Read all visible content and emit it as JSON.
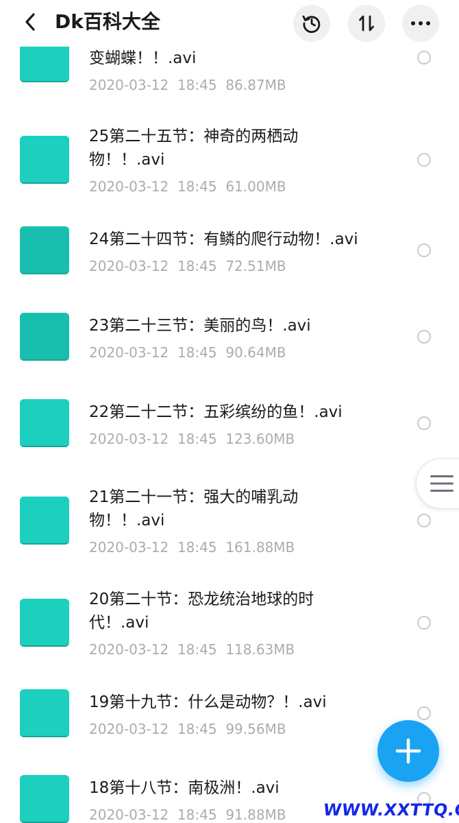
{
  "header": {
    "title": "Dk百科大全",
    "icons": {
      "back": "chevron-left-icon",
      "history": "history-icon",
      "sort": "sort-icon",
      "more": "more-dots-icon"
    }
  },
  "files": [
    {
      "name": "变蝴蝶！！.avi",
      "date": "2020-03-12",
      "time": "18:45",
      "size": "86.87MB"
    },
    {
      "name": "25第二十五节：神奇的两栖动物！！.avi",
      "date": "2020-03-12",
      "time": "18:45",
      "size": "61.00MB"
    },
    {
      "name": "24第二十四节：有鳞的爬行动物！.avi",
      "date": "2020-03-12",
      "time": "18:45",
      "size": "72.51MB"
    },
    {
      "name": "23第二十三节：美丽的鸟！.avi",
      "date": "2020-03-12",
      "time": "18:45",
      "size": "90.64MB"
    },
    {
      "name": "22第二十二节：五彩缤纷的鱼！.avi",
      "date": "2020-03-12",
      "time": "18:45",
      "size": "123.60MB"
    },
    {
      "name": "21第二十一节：强大的哺乳动物！！.avi",
      "date": "2020-03-12",
      "time": "18:45",
      "size": "161.88MB"
    },
    {
      "name": "20第二十节：恐龙统治地球的时代！.avi",
      "date": "2020-03-12",
      "time": "18:45",
      "size": "118.63MB"
    },
    {
      "name": "19第十九节：什么是动物？！.avi",
      "date": "2020-03-12",
      "time": "18:45",
      "size": "99.56MB"
    },
    {
      "name": "18第十八节：南极洲！.avi",
      "date": "2020-03-12",
      "time": "18:45",
      "size": "91.88MB"
    }
  ],
  "fab": {
    "icon": "plus-icon"
  },
  "side_handle": {
    "icon": "menu-lines-icon"
  },
  "watermark": "WWW.XXTTQ.COM",
  "colors": {
    "thumbnail": "#1ccfbe",
    "fab": "#1aa3f2",
    "meta_text": "#a8acb2",
    "watermark": "#1428e6"
  }
}
